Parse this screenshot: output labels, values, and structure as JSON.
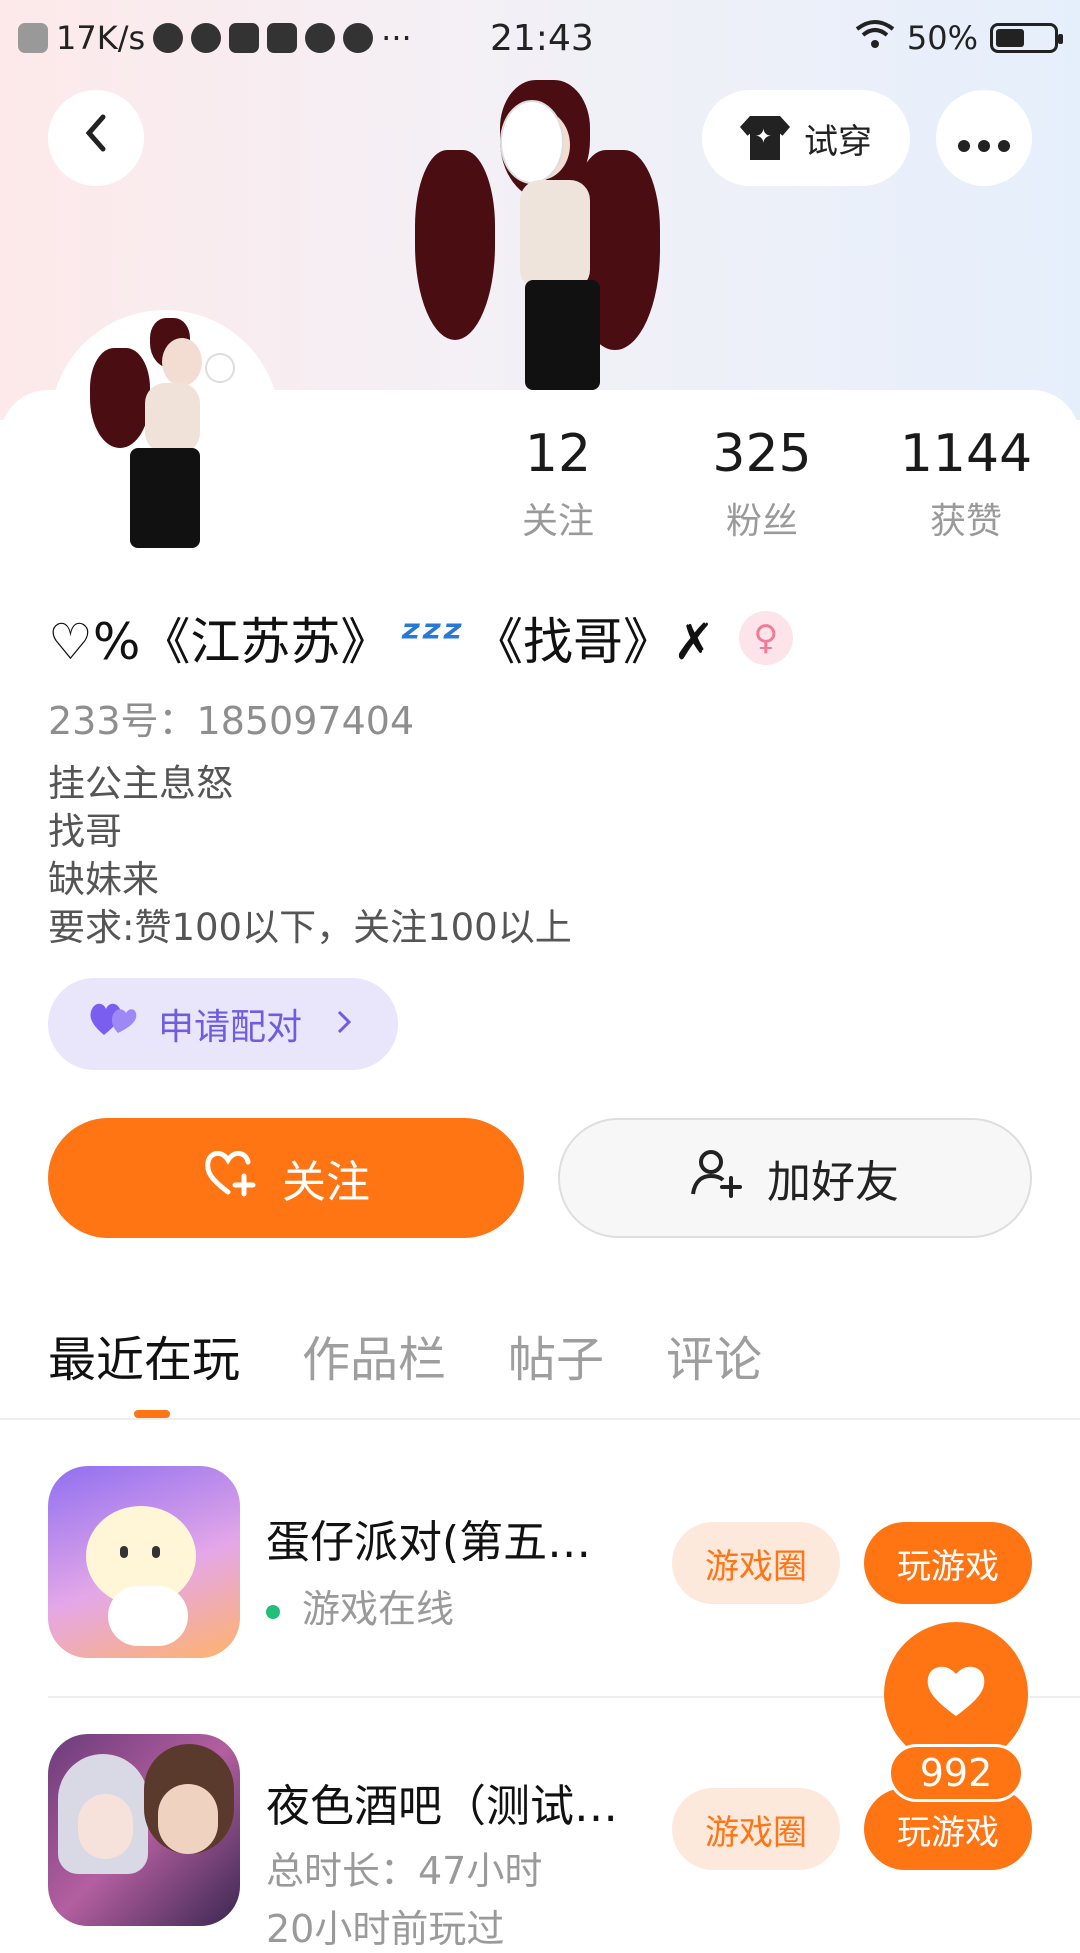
{
  "status_bar": {
    "network_speed": "17K/s",
    "time": "21:43",
    "battery": "50%",
    "more": "···"
  },
  "header": {
    "back_icon": "chevron-left-icon",
    "try_on_label": "试穿",
    "more_icon": "ellipsis-icon"
  },
  "profile": {
    "stats": [
      {
        "value": "12",
        "label": "关注"
      },
      {
        "value": "325",
        "label": "粉丝"
      },
      {
        "value": "1144",
        "label": "获赞"
      }
    ],
    "nickname_prefix": "♡%《江苏苏》",
    "nickname_zz": "ᶻᶻᶻ",
    "nickname_suffix": "《找哥》✗",
    "gender_symbol": "♀",
    "id_text": "233号：185097404",
    "bio_lines": [
      "挂公主息怒",
      "找哥",
      "缺妹来",
      "要求:赞100以下，关注100以上"
    ],
    "pair_label": "申请配对",
    "follow_label": "关注",
    "add_friend_label": "加好友"
  },
  "tabs": [
    "最近在玩",
    "作品栏",
    "帖子",
    "评论"
  ],
  "games": [
    {
      "title": "蛋仔派对(第五…",
      "status": "游戏在线",
      "circle_label": "游戏圈",
      "play_label": "玩游戏"
    },
    {
      "title": "夜色酒吧（测试…",
      "duration": "总时长：47小时",
      "last_played": "20小时前玩过",
      "circle_label": "游戏圈",
      "play_label": "玩游戏"
    }
  ],
  "like": {
    "count": "992"
  },
  "colors": {
    "accent": "#ff7413",
    "online": "#20c07a",
    "pair": "#6f5ce0"
  }
}
